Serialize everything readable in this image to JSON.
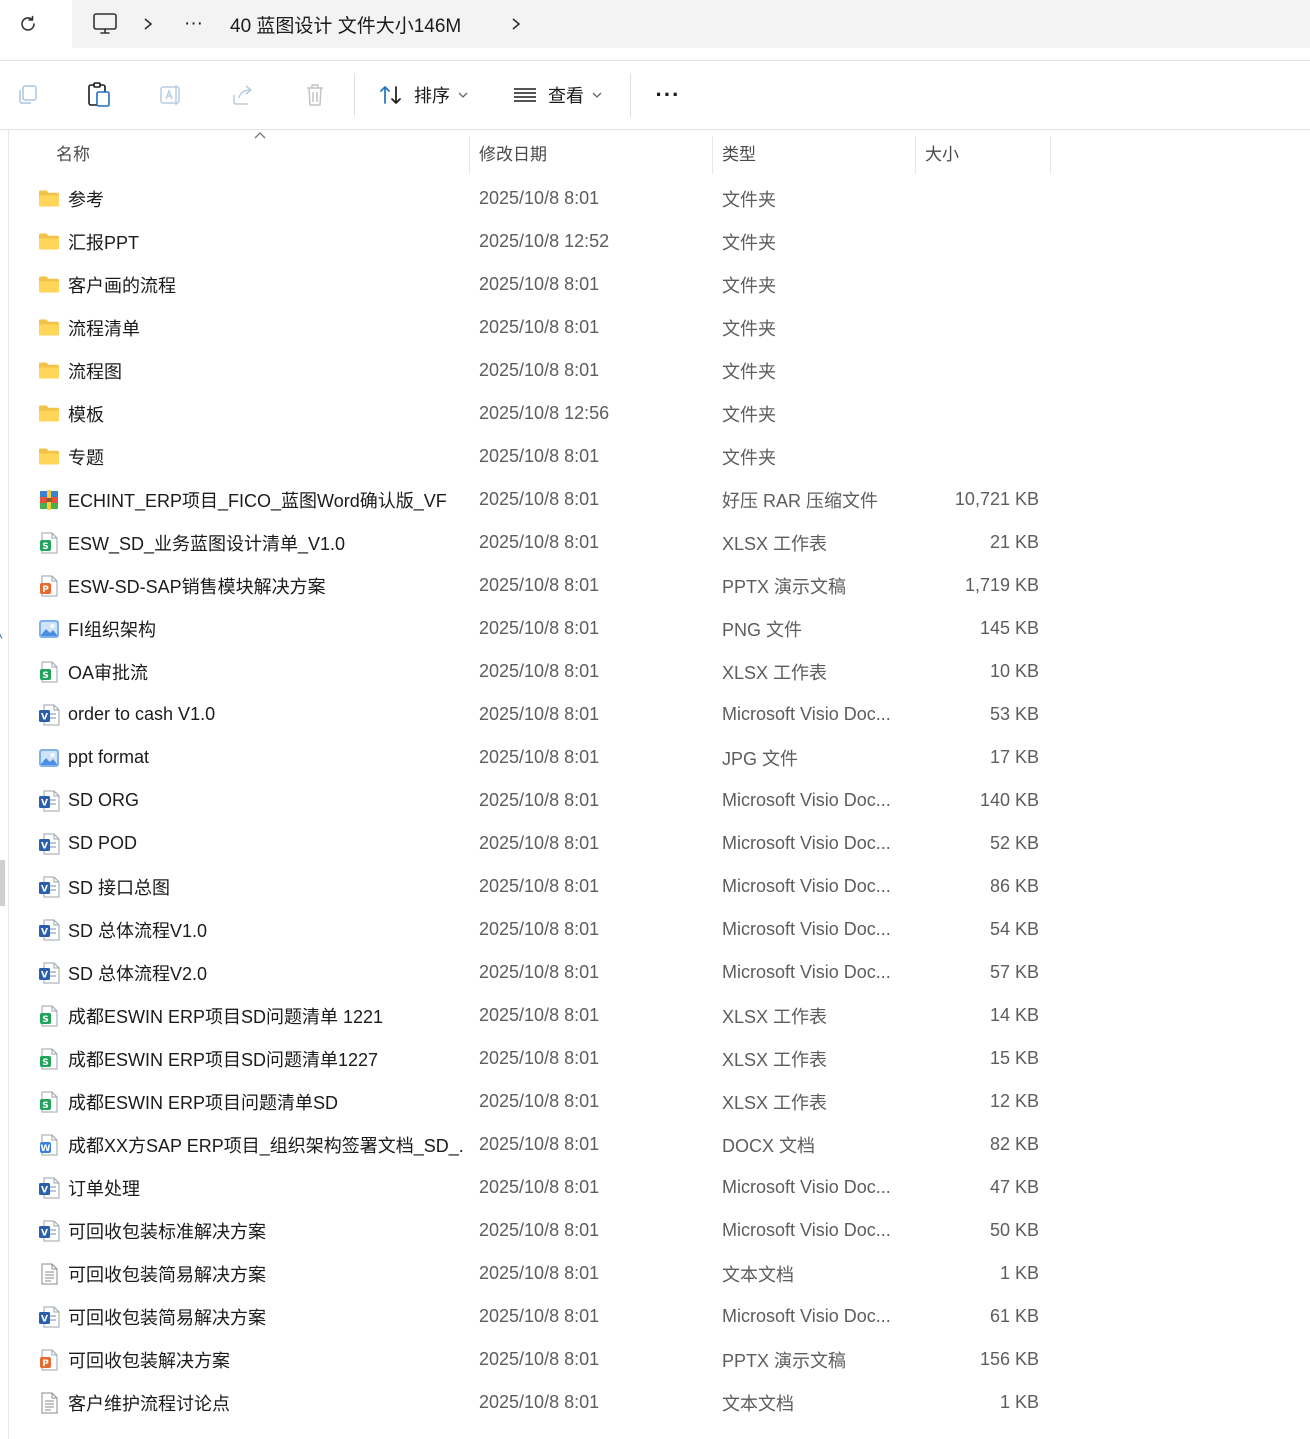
{
  "address": {
    "crumbs": [
      "40 蓝图设计 文件大小146M"
    ],
    "overflow": "···"
  },
  "toolbar": {
    "sort_label": "排序",
    "view_label": "查看",
    "more_label": "···"
  },
  "columns": {
    "name": "名称",
    "date": "修改日期",
    "type": "类型",
    "size": "大小"
  },
  "files": [
    {
      "name": "参考",
      "date": "2025/10/8 8:01",
      "type": "文件夹",
      "size": "",
      "icon": "folder-icon"
    },
    {
      "name": "汇报PPT",
      "date": "2025/10/8 12:52",
      "type": "文件夹",
      "size": "",
      "icon": "folder-icon"
    },
    {
      "name": "客户画的流程",
      "date": "2025/10/8 8:01",
      "type": "文件夹",
      "size": "",
      "icon": "folder-icon"
    },
    {
      "name": "流程清单",
      "date": "2025/10/8 8:01",
      "type": "文件夹",
      "size": "",
      "icon": "folder-icon"
    },
    {
      "name": "流程图",
      "date": "2025/10/8 8:01",
      "type": "文件夹",
      "size": "",
      "icon": "folder-icon"
    },
    {
      "name": "模板",
      "date": "2025/10/8 12:56",
      "type": "文件夹",
      "size": "",
      "icon": "folder-icon"
    },
    {
      "name": "专题",
      "date": "2025/10/8 8:01",
      "type": "文件夹",
      "size": "",
      "icon": "folder-icon"
    },
    {
      "name": "ECHINT_ERP项目_FICO_蓝图Word确认版_VF",
      "date": "2025/10/8 8:01",
      "type": "好压 RAR 压缩文件",
      "size": "10,721 KB",
      "icon": "rar-icon"
    },
    {
      "name": "ESW_SD_业务蓝图设计清单_V1.0",
      "date": "2025/10/8 8:01",
      "type": "XLSX 工作表",
      "size": "21 KB",
      "icon": "xlsx-icon"
    },
    {
      "name": "ESW-SD-SAP销售模块解决方案",
      "date": "2025/10/8 8:01",
      "type": "PPTX 演示文稿",
      "size": "1,719 KB",
      "icon": "pptx-icon"
    },
    {
      "name": "FI组织架构",
      "date": "2025/10/8 8:01",
      "type": "PNG 文件",
      "size": "145 KB",
      "icon": "image-icon"
    },
    {
      "name": "OA审批流",
      "date": "2025/10/8 8:01",
      "type": "XLSX 工作表",
      "size": "10 KB",
      "icon": "xlsx-icon"
    },
    {
      "name": "order to cash V1.0",
      "date": "2025/10/8 8:01",
      "type": "Microsoft Visio Doc...",
      "size": "53 KB",
      "icon": "visio-icon"
    },
    {
      "name": "ppt format",
      "date": "2025/10/8 8:01",
      "type": "JPG 文件",
      "size": "17 KB",
      "icon": "image-icon"
    },
    {
      "name": "SD ORG",
      "date": "2025/10/8 8:01",
      "type": "Microsoft Visio Doc...",
      "size": "140 KB",
      "icon": "visio-icon"
    },
    {
      "name": "SD POD",
      "date": "2025/10/8 8:01",
      "type": "Microsoft Visio Doc...",
      "size": "52 KB",
      "icon": "visio-icon"
    },
    {
      "name": "SD 接口总图",
      "date": "2025/10/8 8:01",
      "type": "Microsoft Visio Doc...",
      "size": "86 KB",
      "icon": "visio-icon"
    },
    {
      "name": "SD 总体流程V1.0",
      "date": "2025/10/8 8:01",
      "type": "Microsoft Visio Doc...",
      "size": "54 KB",
      "icon": "visio-icon"
    },
    {
      "name": "SD 总体流程V2.0",
      "date": "2025/10/8 8:01",
      "type": "Microsoft Visio Doc...",
      "size": "57 KB",
      "icon": "visio-icon"
    },
    {
      "name": "成都ESWIN ERP项目SD问题清单 1221",
      "date": "2025/10/8 8:01",
      "type": "XLSX 工作表",
      "size": "14 KB",
      "icon": "xlsx-icon"
    },
    {
      "name": "成都ESWIN ERP项目SD问题清单1227",
      "date": "2025/10/8 8:01",
      "type": "XLSX 工作表",
      "size": "15 KB",
      "icon": "xlsx-icon"
    },
    {
      "name": "成都ESWIN ERP项目问题清单SD",
      "date": "2025/10/8 8:01",
      "type": "XLSX 工作表",
      "size": "12 KB",
      "icon": "xlsx-icon"
    },
    {
      "name": "成都XX方SAP ERP项目_组织架构签署文档_SD_...",
      "date": "2025/10/8 8:01",
      "type": "DOCX 文档",
      "size": "82 KB",
      "icon": "docx-icon"
    },
    {
      "name": "订单处理",
      "date": "2025/10/8 8:01",
      "type": "Microsoft Visio Doc...",
      "size": "47 KB",
      "icon": "visio-icon"
    },
    {
      "name": "可回收包装标准解决方案",
      "date": "2025/10/8 8:01",
      "type": "Microsoft Visio Doc...",
      "size": "50 KB",
      "icon": "visio-icon"
    },
    {
      "name": "可回收包装简易解决方案",
      "date": "2025/10/8 8:01",
      "type": "文本文档",
      "size": "1 KB",
      "icon": "text-icon"
    },
    {
      "name": "可回收包装简易解决方案",
      "date": "2025/10/8 8:01",
      "type": "Microsoft Visio Doc...",
      "size": "61 KB",
      "icon": "visio-icon"
    },
    {
      "name": "可回收包装解决方案",
      "date": "2025/10/8 8:01",
      "type": "PPTX 演示文稿",
      "size": "156 KB",
      "icon": "pptx-icon"
    },
    {
      "name": "客户维护流程讨论点",
      "date": "2025/10/8 8:01",
      "type": "文本文档",
      "size": "1 KB",
      "icon": "text-icon"
    }
  ]
}
